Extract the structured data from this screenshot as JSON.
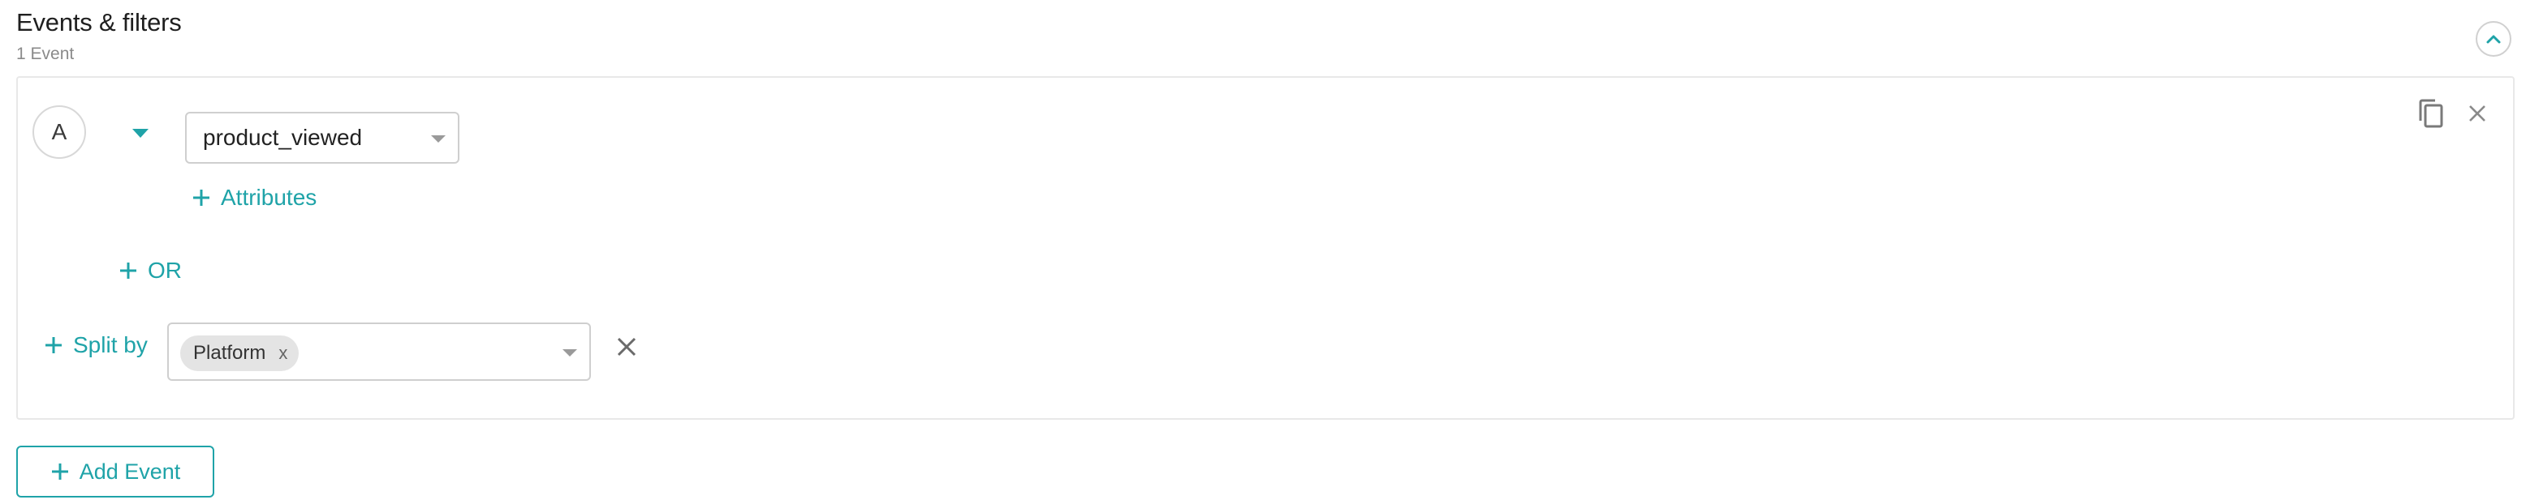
{
  "section": {
    "title": "Events & filters",
    "subtitle": "1 Event"
  },
  "event": {
    "letter": "A",
    "selected_event": "product_viewed",
    "attributes_label": "Attributes",
    "or_label": "OR"
  },
  "split": {
    "label": "Split by",
    "chips": [
      {
        "label": "Platform",
        "remove": "x"
      }
    ]
  },
  "footer": {
    "add_event_label": "Add Event"
  },
  "icons": {
    "collapse": "chevron-up-icon",
    "caret": "caret-down-icon",
    "copy": "copy-icon",
    "close": "close-icon",
    "plus": "plus-icon"
  },
  "colors": {
    "accent": "#1fa3a8",
    "border": "#cfcfcf",
    "chip_bg": "#e4e4e4",
    "muted_text": "#8a8a8a"
  }
}
